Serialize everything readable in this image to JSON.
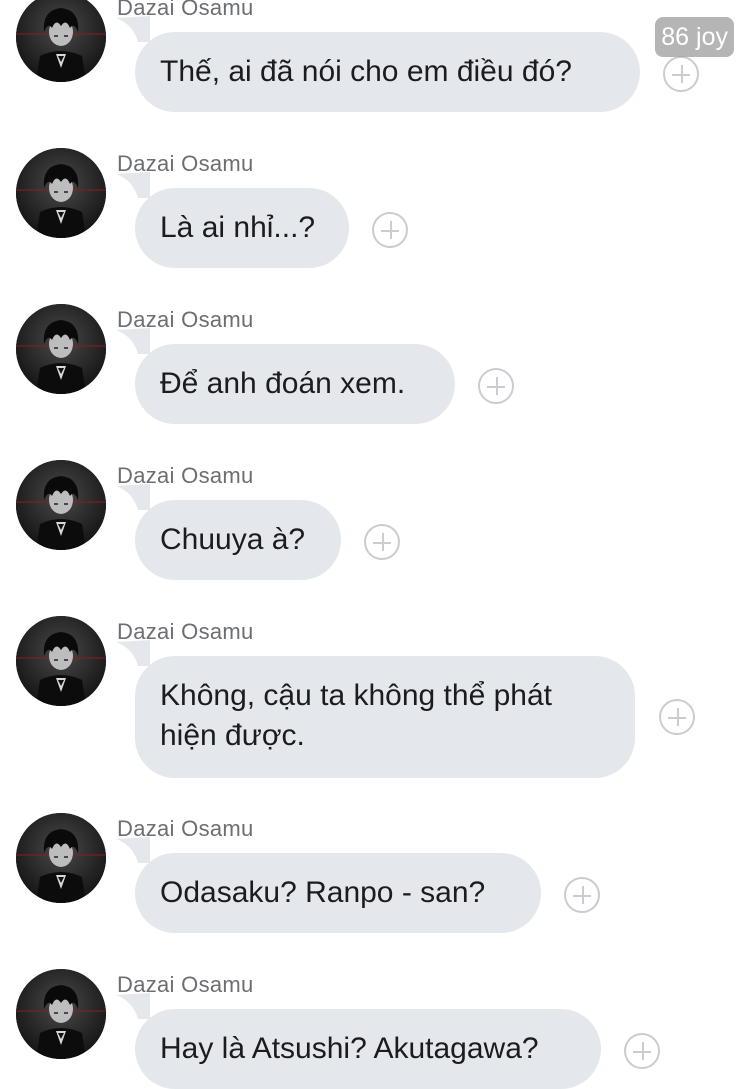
{
  "watermark": "86 joy",
  "messages": [
    {
      "sender": "Dazai Osamu",
      "text": "Thế, ai đã nói cho em điều đó?"
    },
    {
      "sender": "Dazai Osamu",
      "text": "Là ai nhỉ...?"
    },
    {
      "sender": "Dazai Osamu",
      "text": "Để anh đoán xem."
    },
    {
      "sender": "Dazai Osamu",
      "text": "Chuuya à?"
    },
    {
      "sender": "Dazai Osamu",
      "text": "Không, cậu ta không thể phát hiện được."
    },
    {
      "sender": "Dazai Osamu",
      "text": "Odasaku? Ranpo - san?"
    },
    {
      "sender": "Dazai Osamu",
      "text": "Hay là Atsushi? Akutagawa?"
    }
  ],
  "icons": {
    "avatar": "dark-anime-avatar",
    "react": "add-reaction-icon"
  },
  "colors": {
    "bubble": "#e4e7ec",
    "sender": "#6b6e72",
    "text": "#1c1c1e",
    "react_icon": "#c9ccd1"
  }
}
